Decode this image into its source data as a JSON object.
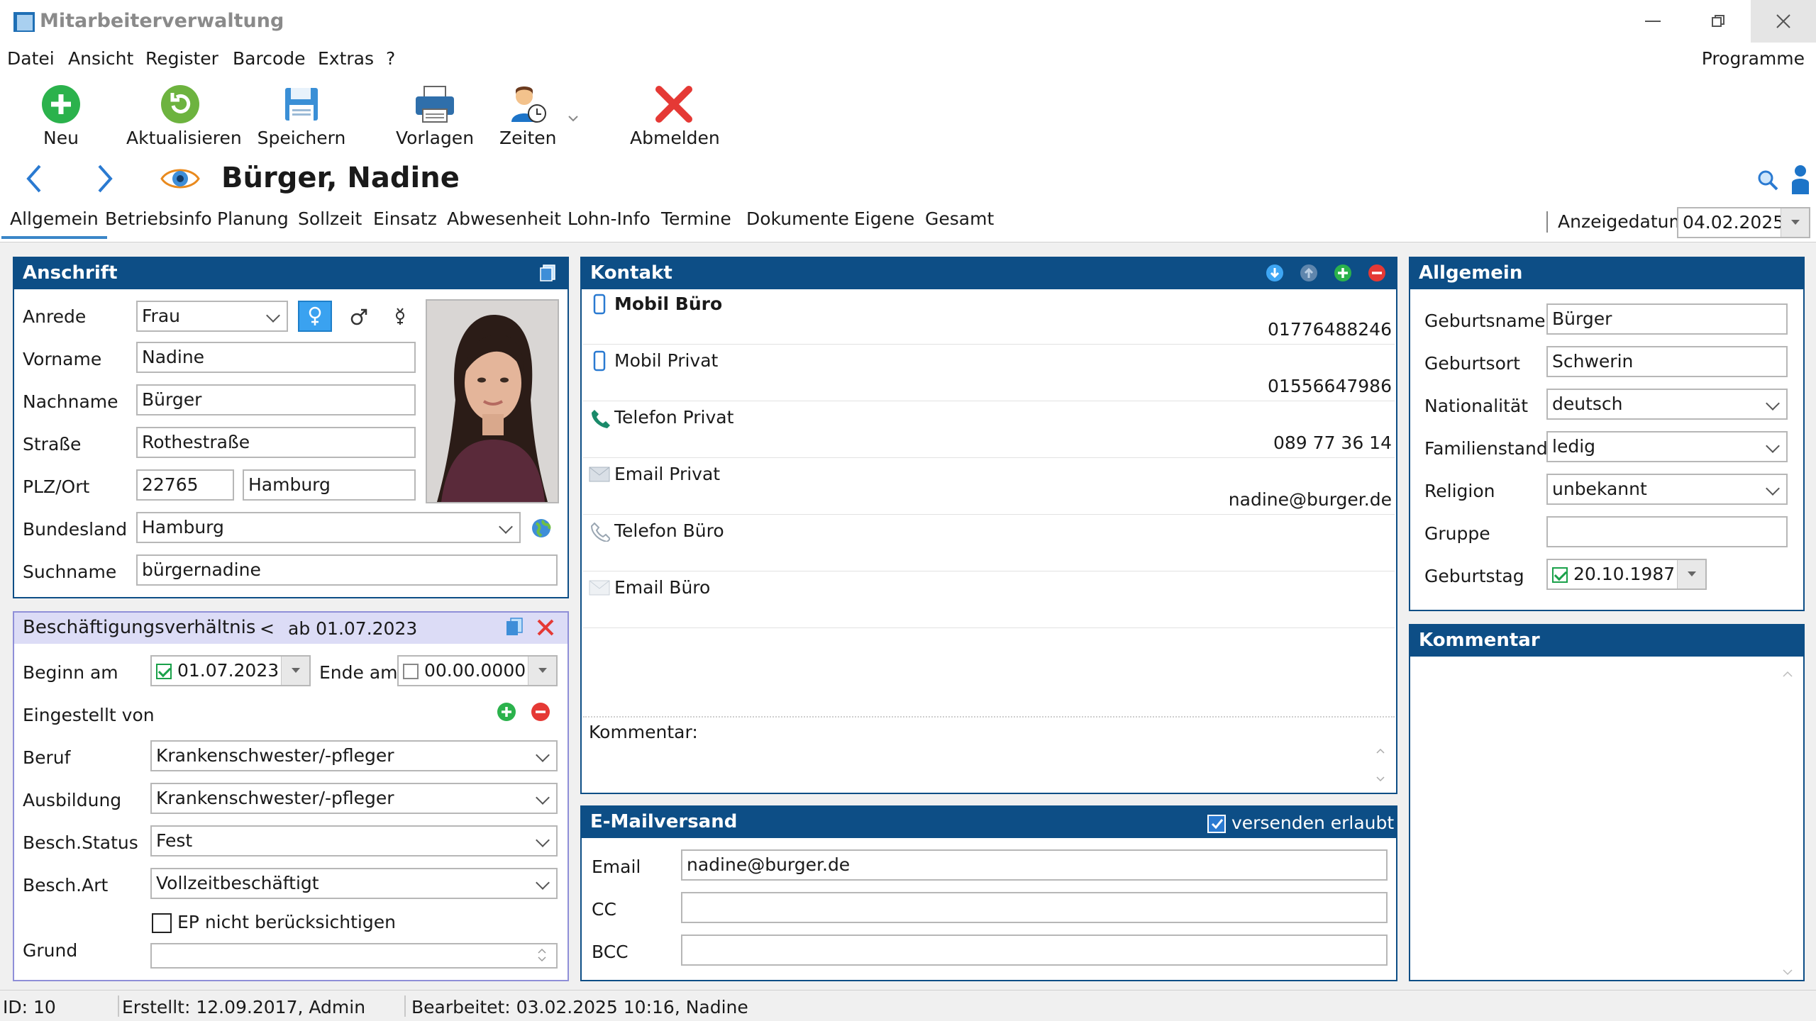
{
  "window": {
    "title": "Mitarbeiterverwaltung"
  },
  "menu": {
    "items": [
      "Datei",
      "Ansicht",
      "Register",
      "Barcode",
      "Extras",
      "?"
    ],
    "right": "Programme"
  },
  "toolbar": {
    "new": "Neu",
    "refresh": "Aktualisieren",
    "save": "Speichern",
    "templates": "Vorlagen",
    "times": "Zeiten",
    "logout": "Abmelden"
  },
  "person": {
    "name": "Bürger, Nadine"
  },
  "tabs": [
    "Allgemein",
    "Betriebsinfo",
    "Planung",
    "Sollzeit",
    "Einsatz",
    "Abwesenheit",
    "Lohn-Info",
    "Termine",
    "Dokumente",
    "Eigene",
    "Gesamt"
  ],
  "display_date": {
    "label": "Anzeigedatum",
    "value": "04.02.2025"
  },
  "address": {
    "title": "Anschrift",
    "salutation_label": "Anrede",
    "salutation": "Frau",
    "firstname_label": "Vorname",
    "firstname": "Nadine",
    "lastname_label": "Nachname",
    "lastname": "Bürger",
    "street_label": "Straße",
    "street": "Rothestraße",
    "zip_city_label": "PLZ/Ort",
    "zip": "22765",
    "city": "Hamburg",
    "state_label": "Bundesland",
    "state": "Hamburg",
    "searchname_label": "Suchname",
    "searchname": "bürgernadine"
  },
  "employment": {
    "title": "Beschäftigungsverhältnis",
    "prev": "<",
    "since": "ab 01.07.2023",
    "begin_label": "Beginn am",
    "begin": "01.07.2023",
    "end_label": "Ende am",
    "end": "00.00.0000",
    "hired_by_label": "Eingestellt von",
    "job_label": "Beruf",
    "job": "Krankenschwester/-pfleger",
    "training_label": "Ausbildung",
    "training": "Krankenschwester/-pfleger",
    "status_label": "Besch.Status",
    "status": "Fest",
    "type_label": "Besch.Art",
    "type": "Vollzeitbeschäftigt",
    "ep_label": "EP nicht berücksichtigen",
    "reason_label": "Grund",
    "reason": ""
  },
  "contact": {
    "title": "Kontakt",
    "rows": [
      {
        "label": "Mobil Büro",
        "value": "01776488246"
      },
      {
        "label": "Mobil Privat",
        "value": "01556647986"
      },
      {
        "label": "Telefon Privat",
        "value": "089 77 36 14"
      },
      {
        "label": "Email Privat",
        "value": "nadine@burger.de"
      },
      {
        "label": "Telefon Büro",
        "value": ""
      },
      {
        "label": "Email Büro",
        "value": ""
      }
    ],
    "comment_label": "Kommentar:"
  },
  "email": {
    "title": "E-Mailversand",
    "allowed_label": "versenden erlaubt",
    "email_label": "Email",
    "email": "nadine@burger.de",
    "cc_label": "CC",
    "cc": "",
    "bcc_label": "BCC",
    "bcc": ""
  },
  "general": {
    "title": "Allgemein",
    "birthname_label": "Geburtsname",
    "birthname": "Bürger",
    "birthplace_label": "Geburtsort",
    "birthplace": "Schwerin",
    "nationality_label": "Nationalität",
    "nationality": "deutsch",
    "marital_label": "Familienstand",
    "marital": "ledig",
    "religion_label": "Religion",
    "religion": "unbekannt",
    "group_label": "Gruppe",
    "group": "",
    "birthday_label": "Geburtstag",
    "birthday": "20.10.1987"
  },
  "comment": {
    "title": "Kommentar"
  },
  "status": {
    "id": "ID: 10",
    "created": "Erstellt: 12.09.2017, Admin",
    "edited": "Bearbeitet: 03.02.2025 10:16, Nadine"
  },
  "colors": {
    "panel_header": "#0d4e86",
    "accent": "#3b86c8",
    "green": "#1aa14a",
    "red": "#e53935"
  }
}
